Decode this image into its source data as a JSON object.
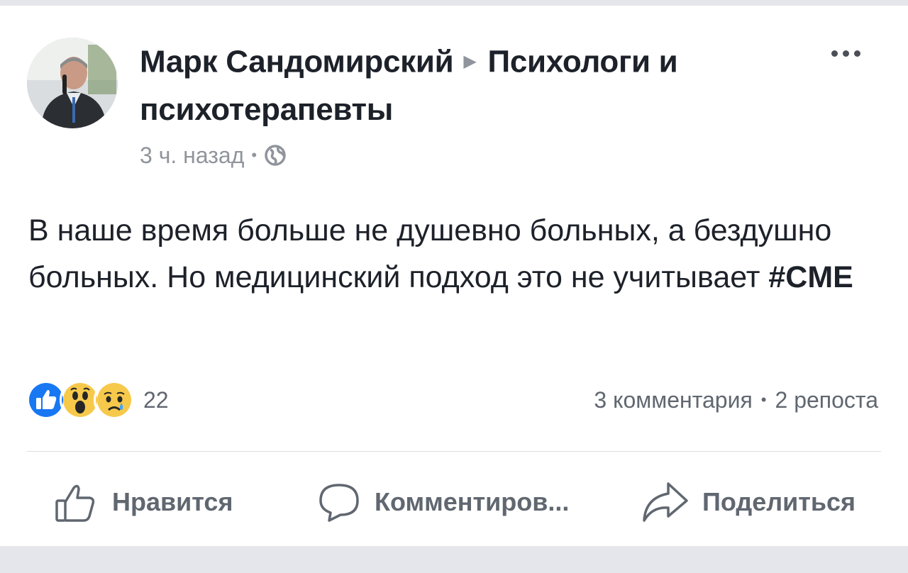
{
  "post": {
    "author": "Марк Сандомирский",
    "group_line1": "Психологи и",
    "group_line2": "психотерапевты",
    "time": "3 ч. назад",
    "privacy_icon": "globe-icon",
    "text_main": "В наше время больше не душевно больных, а бездушно больных. Но медицинский подход это не учитывает ",
    "hashtag": "#CME"
  },
  "reactions": {
    "icons": [
      "like-icon",
      "wow-icon",
      "sad-icon"
    ],
    "count": "22",
    "comments": "3 комментария",
    "shares": "2 репоста"
  },
  "actions": {
    "like": "Нравится",
    "comment": "Комментиров...",
    "share": "Поделиться"
  },
  "colors": {
    "like_blue": "#1877f2",
    "emoji_yellow": "#f7c94b",
    "text": "#1d2129",
    "muted": "#606770"
  }
}
